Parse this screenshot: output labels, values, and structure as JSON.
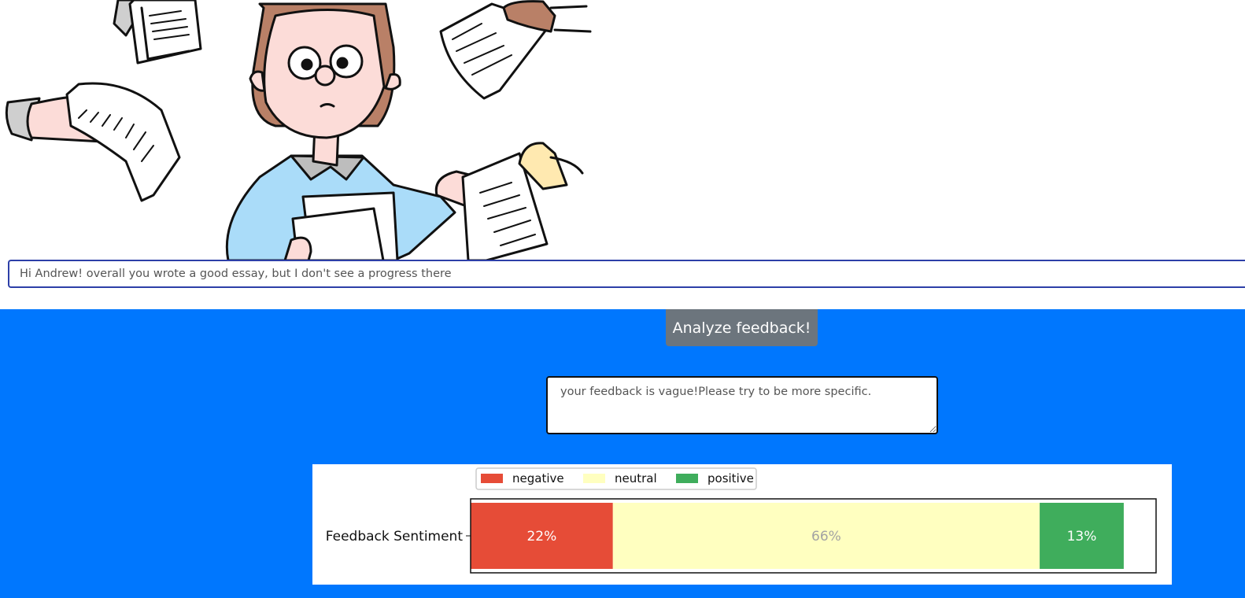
{
  "input": {
    "value": "Hi Andrew! overall you wrote a good essay, but I don't see a progress there"
  },
  "analyze_button": {
    "label": "Analyze feedback!"
  },
  "result": {
    "text": "your feedback is vague!Please try to be more specific."
  },
  "colors": {
    "panel_background": "#0077fe",
    "button_background": "#6c757d",
    "negative": "#e64c37",
    "neutral": "#ffffc0",
    "positive": "#3fad5c"
  },
  "chart_data": {
    "type": "bar",
    "orientation": "horizontal",
    "stacked": true,
    "categories": [
      "Feedback Sentiment"
    ],
    "series": [
      {
        "name": "negative",
        "values": [
          22
        ],
        "label": "22%",
        "color": "#e64c37",
        "label_color": "#ffffff"
      },
      {
        "name": "neutral",
        "values": [
          66
        ],
        "label": "66%",
        "color": "#ffffc0",
        "label_color": "#a3a3a3"
      },
      {
        "name": "positive",
        "values": [
          13
        ],
        "label": "13%",
        "color": "#3fad5c",
        "label_color": "#ffffff"
      }
    ],
    "xlim": [
      0,
      106
    ],
    "legend": "top-left",
    "grid": false
  }
}
